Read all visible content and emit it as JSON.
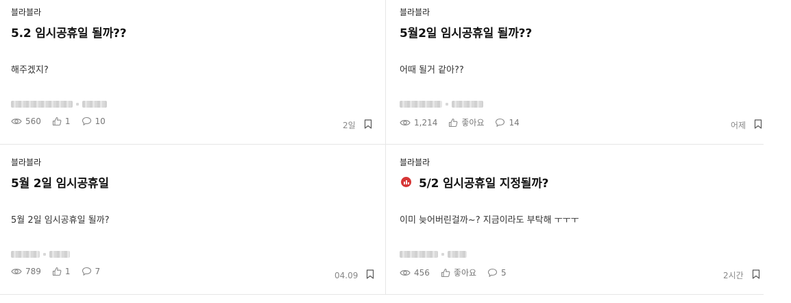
{
  "posts": [
    {
      "topic": "블라블라",
      "title": "5.2 임시공휴일 될까??",
      "body": "해주겠지?",
      "hot": false,
      "views": "560",
      "likes": "1",
      "comments": "10",
      "time": "2일"
    },
    {
      "topic": "블라블라",
      "title": "5월2일 임시공휴일 될까??",
      "body": "어때 될거 같아??",
      "hot": false,
      "views": "1,214",
      "likes": "좋아요",
      "comments": "14",
      "time": "어제"
    },
    {
      "topic": "블라블라",
      "title": "5월 2일 임시공휴일",
      "body": "5월 2일 임시공휴일 될까?",
      "hot": false,
      "views": "789",
      "likes": "1",
      "comments": "7",
      "time": "04.09"
    },
    {
      "topic": "블라블라",
      "title": "5/2 임시공휴일 지정될까?",
      "body": "이미 늦어버린걸까~? 지금이라도 부탁해 ㅜㅜㅜ",
      "hot": true,
      "views": "456",
      "likes": "좋아요",
      "comments": "5",
      "time": "2시간"
    }
  ],
  "icons": {
    "views": "eye-icon",
    "likes": "thumbs-up-icon",
    "comments": "comment-icon",
    "bookmark": "bookmark-icon",
    "hot": "trending-chart-icon"
  },
  "colors": {
    "hot_badge": "#d63636",
    "divider": "#e6e6e6",
    "meta_text": "#777777"
  }
}
